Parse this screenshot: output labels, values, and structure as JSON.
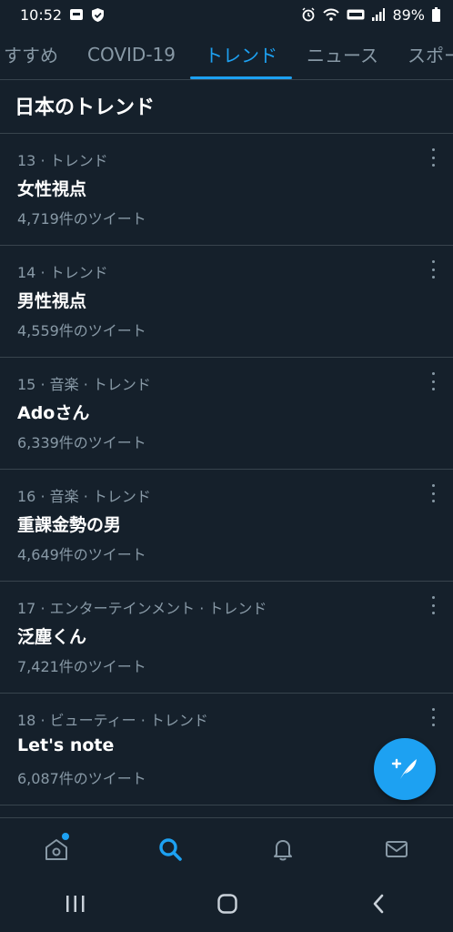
{
  "status": {
    "time": "10:52",
    "battery": "89%"
  },
  "tabs": [
    {
      "label": "すすめ",
      "active": false
    },
    {
      "label": "COVID-19",
      "active": false
    },
    {
      "label": "トレンド",
      "active": true
    },
    {
      "label": "ニュース",
      "active": false
    },
    {
      "label": "スポーツ",
      "active": false
    }
  ],
  "section_title": "日本のトレンド",
  "trends": [
    {
      "meta": "13 · トレンド",
      "name": "女性視点",
      "count": "4,719件のツイート"
    },
    {
      "meta": "14 · トレンド",
      "name": "男性視点",
      "count": "4,559件のツイート"
    },
    {
      "meta": "15 · 音楽 · トレンド",
      "name": "Adoさん",
      "count": "6,339件のツイート"
    },
    {
      "meta": "16 · 音楽 · トレンド",
      "name": "重課金勢の男",
      "count": "4,649件のツイート"
    },
    {
      "meta": "17 · エンターテインメント · トレンド",
      "name": "泛塵くん",
      "count": "7,421件のツイート"
    },
    {
      "meta": "18 · ビューティー · トレンド",
      "name": "Let's note",
      "count": "6,087件のツイート"
    }
  ],
  "colors": {
    "background": "#15202b",
    "accent": "#1da1f2",
    "muted": "#8899a6",
    "divider": "#38444d"
  },
  "icons": {
    "fab": "compose-tweet-icon",
    "nav": [
      "home-icon",
      "search-icon",
      "notifications-icon",
      "messages-icon"
    ],
    "system": [
      "recent-apps-icon",
      "home-button-icon",
      "back-icon"
    ]
  }
}
